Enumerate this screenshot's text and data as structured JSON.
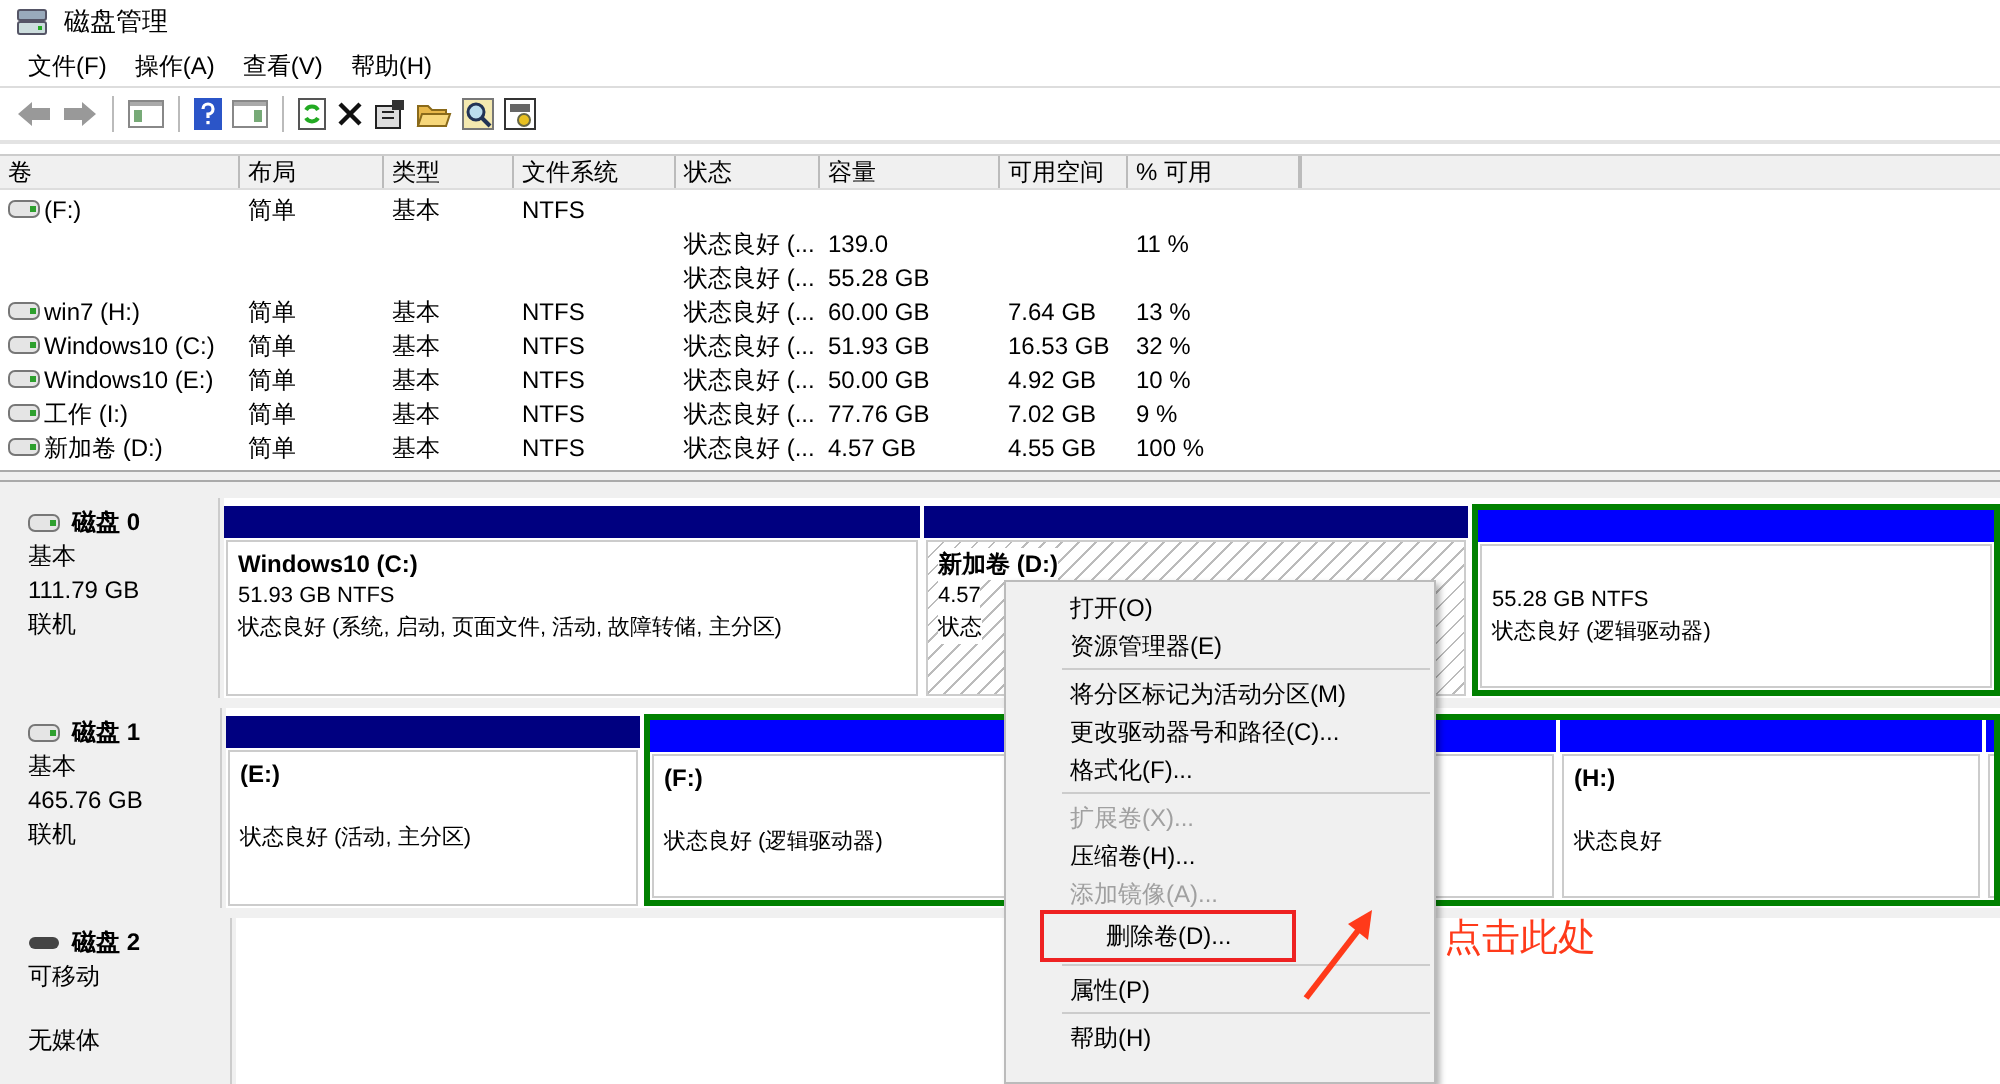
{
  "window": {
    "title": "磁盘管理"
  },
  "menu_bar": [
    "文件(F)",
    "操作(A)",
    "查看(V)",
    "帮助(H)"
  ],
  "toolbar": [
    {
      "kind": "back"
    },
    {
      "kind": "forward"
    },
    {
      "kind": "sep"
    },
    {
      "kind": "tree"
    },
    {
      "kind": "sep"
    },
    {
      "kind": "help"
    },
    {
      "kind": "pane"
    },
    {
      "kind": "sep"
    },
    {
      "kind": "refresh"
    },
    {
      "kind": "delete"
    },
    {
      "kind": "properties"
    },
    {
      "kind": "folder"
    },
    {
      "kind": "search"
    },
    {
      "kind": "settings"
    }
  ],
  "table": {
    "columns": [
      "卷",
      "布局",
      "类型",
      "文件系统",
      "状态",
      "容量",
      "可用空间",
      "% 可用"
    ],
    "rows": [
      [
        "(F:)",
        "简单",
        "基本",
        "NTFS",
        null,
        null,
        null,
        null
      ],
      [
        null,
        null,
        null,
        null,
        "状态良好 (...",
        "139.0",
        null,
        "11 %"
      ],
      [
        null,
        null,
        null,
        null,
        "状态良好 (...",
        "55.28 GB",
        null,
        null
      ],
      [
        "win7 (H:)",
        "简单",
        "基本",
        "NTFS",
        "状态良好 (...",
        "60.00 GB",
        "7.64 GB",
        "13 %"
      ],
      [
        "Windows10 (C:)",
        "简单",
        "基本",
        "NTFS",
        "状态良好 (...",
        "51.93 GB",
        "16.53 GB",
        "32 %"
      ],
      [
        "Windows10 (E:)",
        "简单",
        "基本",
        "NTFS",
        "状态良好 (...",
        "50.00 GB",
        "4.92 GB",
        "10 %"
      ],
      [
        "工作 (I:)",
        "简单",
        "基本",
        "NTFS",
        "状态良好 (...",
        "77.76 GB",
        "7.02 GB",
        "9 %"
      ],
      [
        "新加卷 (D:)",
        "简单",
        "基本",
        "NTFS",
        "状态良好 (...",
        "4.57 GB",
        "4.55 GB",
        "100 %"
      ]
    ]
  },
  "disks": [
    {
      "name": "磁盘 0",
      "type": "基本",
      "size": "111.79 GB",
      "state": "联机",
      "kind": "fixed",
      "partitions": [
        {
          "kind": "primary",
          "selected": false,
          "title": "Windows10  (C:)",
          "size": "51.93 GB NTFS",
          "status": "状态良好 (系统, 启动, 页面文件, 活动, 故障转储, 主分区)"
        },
        {
          "kind": "primary",
          "selected": true,
          "title": "新加卷  (D:)",
          "size": "4.57",
          "status": "状态"
        },
        {
          "kind": "logical",
          "selected": false,
          "size": "55.28 GB NTFS",
          "status": "状态良好 (逻辑驱动器)"
        }
      ]
    },
    {
      "name": "磁盘 1",
      "type": "基本",
      "size": "465.76 GB",
      "state": "联机",
      "kind": "fixed",
      "partitions": [
        {
          "kind": "primary",
          "selected": false,
          "title": "(E:)",
          "status": "状态良好 (活动, 主分区)"
        },
        {
          "kind": "logical",
          "selected": false,
          "title": "(F:)",
          "status": "状态良好 (逻辑驱动器)"
        },
        {
          "kind": "logical",
          "selected": false,
          "title": "(H:)",
          "status": "状态良好"
        },
        {
          "kind": "logical",
          "selected": false
        }
      ]
    },
    {
      "name": "磁盘 2",
      "type": "可移动",
      "state": "无媒体",
      "kind": "removable"
    }
  ],
  "context_menu": [
    {
      "kind": "item",
      "label": "打开(O)",
      "disabled": false,
      "marked": false
    },
    {
      "kind": "item",
      "label": "资源管理器(E)",
      "disabled": false,
      "marked": false
    },
    {
      "kind": "separator"
    },
    {
      "kind": "item",
      "label": "将分区标记为活动分区(M)",
      "disabled": false,
      "marked": false
    },
    {
      "kind": "item",
      "label": "更改驱动器号和路径(C)...",
      "disabled": false,
      "marked": false
    },
    {
      "kind": "item",
      "label": "格式化(F)...",
      "disabled": false,
      "marked": false
    },
    {
      "kind": "separator"
    },
    {
      "kind": "item",
      "label": "扩展卷(X)...",
      "disabled": true,
      "marked": false
    },
    {
      "kind": "item",
      "label": "压缩卷(H)...",
      "disabled": false,
      "marked": false
    },
    {
      "kind": "item",
      "label": "添加镜像(A)...",
      "disabled": true,
      "marked": false
    },
    {
      "kind": "item",
      "label": "删除卷(D)...",
      "disabled": false,
      "marked": true
    },
    {
      "kind": "separator"
    },
    {
      "kind": "item",
      "label": "属性(P)",
      "disabled": false,
      "marked": false
    },
    {
      "kind": "separator"
    },
    {
      "kind": "item",
      "label": "帮助(H)",
      "disabled": false,
      "marked": false
    }
  ],
  "annotation": {
    "text": "点击此处"
  }
}
